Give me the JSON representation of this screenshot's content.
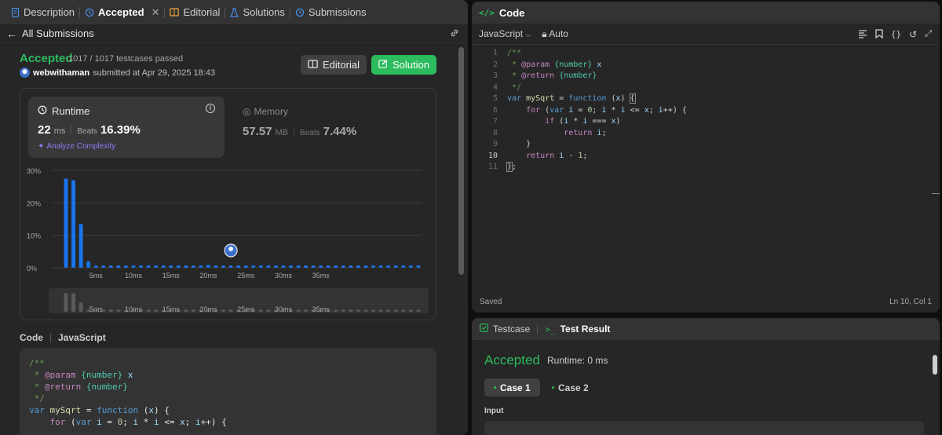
{
  "tabs": [
    {
      "label": "Description",
      "icon": "description-icon"
    },
    {
      "label": "Accepted",
      "icon": "history-icon",
      "active": true
    },
    {
      "label": "Editorial",
      "icon": "book-icon"
    },
    {
      "label": "Solutions",
      "icon": "flask-icon"
    },
    {
      "label": "Submissions",
      "icon": "history-icon"
    }
  ],
  "subbar": {
    "back_label": "All Submissions"
  },
  "result": {
    "status": "Accepted",
    "testcases": "1017 / 1017 testcases passed",
    "username": "webwithaman",
    "submitted": "submitted at Apr 29, 2025 18:43"
  },
  "buttons": {
    "editorial": "Editorial",
    "solution": "Solution"
  },
  "runtime": {
    "label": "Runtime",
    "value": "22",
    "unit": "ms",
    "beats_label": "Beats",
    "beats": "16.39%",
    "analyze": "Analyze Complexity"
  },
  "memory": {
    "label": "Memory",
    "value": "57.57",
    "unit": "MB",
    "beats_label": "Beats",
    "beats": "7.44%"
  },
  "chart_data": {
    "type": "bar",
    "ylim": [
      0,
      30
    ],
    "ytick_labels": [
      "30%",
      "20%",
      "10%",
      "0%"
    ],
    "yticks": [
      30,
      20,
      10,
      0
    ],
    "xtick_labels": [
      "5ms",
      "10ms",
      "15ms",
      "20ms",
      "25ms",
      "30ms",
      "35ms"
    ],
    "xticks": [
      5,
      10,
      15,
      20,
      25,
      30,
      35
    ],
    "x_start": 1,
    "x_step": 1,
    "values": [
      27.5,
      27,
      13.5,
      2,
      0.6,
      0.6,
      0.6,
      0.6,
      0.6,
      0.6,
      0.6,
      0.6,
      0.6,
      0.6,
      0.6,
      0.6,
      0.6,
      0.6,
      0.6,
      0.9,
      0.6,
      0.6,
      0.6,
      0.6,
      0.6,
      0.6,
      0.6,
      0.6,
      0.6,
      0.6,
      0.6,
      0.6,
      0.6,
      0.6,
      0.6,
      0.6,
      0.6,
      0.6,
      0.6,
      0.6,
      0.6,
      0.6,
      0.6,
      0.6,
      0.6,
      0.6,
      0.6,
      0.6,
      0.6,
      0.6,
      0.6,
      0.6,
      0.6
    ],
    "user_x": 23,
    "grid": true,
    "color": "#1a73e8"
  },
  "code_section": {
    "label": "Code",
    "language": "JavaScript"
  },
  "editor": {
    "title": "Code",
    "language": "JavaScript",
    "mode": "Auto",
    "status_saved": "Saved",
    "cursor": "Ln 10, Col 1",
    "line_numbers": [
      "1",
      "2",
      "3",
      "4",
      "5",
      "6",
      "7",
      "8",
      "9",
      "10",
      "11"
    ]
  },
  "test": {
    "tab_testcase": "Testcase",
    "tab_result": "Test Result",
    "status": "Accepted",
    "runtime": "Runtime: 0 ms",
    "case1": "Case 1",
    "case2": "Case 2",
    "input_label": "Input"
  },
  "colors": {
    "accent_green": "#2cbb5d",
    "bar_blue": "#1a73e8",
    "panel": "#262626"
  }
}
